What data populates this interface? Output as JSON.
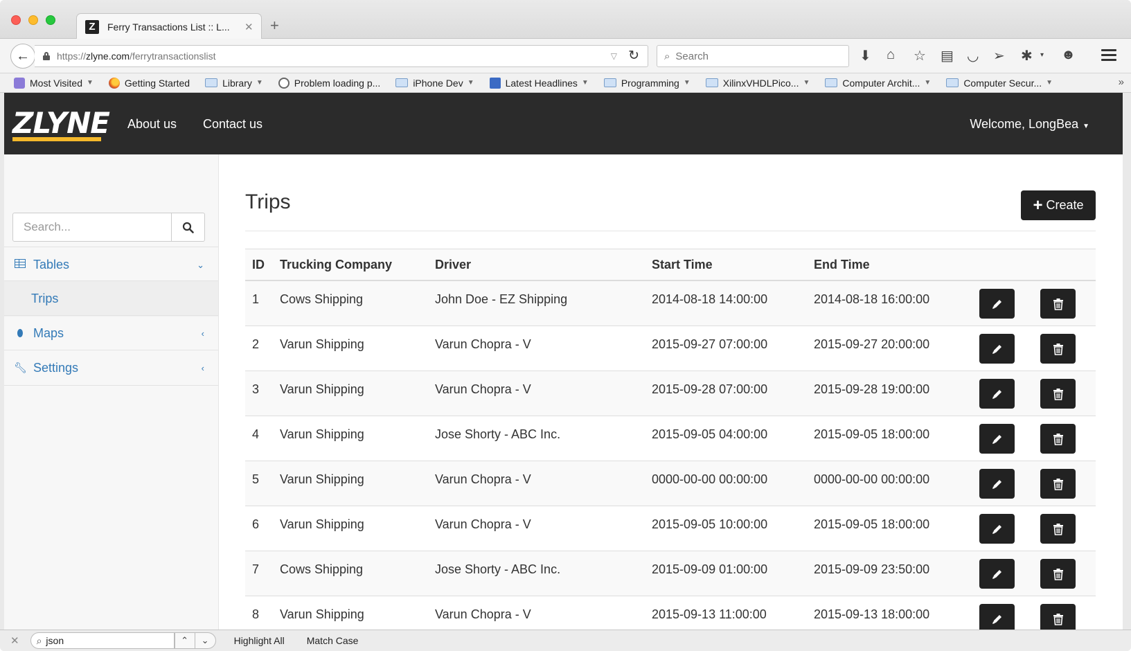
{
  "browser": {
    "tab_title": "Ferry Transactions List :: L...",
    "url_prefix": "https://",
    "url_domain": "zlyne.com",
    "url_path": "/ferrytransactionslist",
    "search_placeholder": "Search",
    "bookmarks": [
      {
        "label": "Most Visited",
        "icon": "most-visited-icon",
        "caret": true
      },
      {
        "label": "Getting Started",
        "icon": "firefox-icon",
        "caret": false
      },
      {
        "label": "Library",
        "icon": "folder-icon",
        "caret": true
      },
      {
        "label": "Problem loading p...",
        "icon": "globe-icon",
        "caret": false
      },
      {
        "label": "iPhone Dev",
        "icon": "folder-icon",
        "caret": true
      },
      {
        "label": "Latest Headlines",
        "icon": "rss-icon",
        "caret": true
      },
      {
        "label": "Programming",
        "icon": "folder-icon",
        "caret": true
      },
      {
        "label": "XilinxVHDLPico...",
        "icon": "folder-icon",
        "caret": true
      },
      {
        "label": "Computer Archit...",
        "icon": "folder-icon",
        "caret": true
      },
      {
        "label": "Computer Secur...",
        "icon": "folder-icon",
        "caret": true
      }
    ]
  },
  "header": {
    "logo_text": "ZLYNE",
    "nav": [
      "About us",
      "Contact us"
    ],
    "welcome": "Welcome, LongBea"
  },
  "sidebar": {
    "search_placeholder": "Search...",
    "items": [
      {
        "label": "Tables",
        "icon": "table-icon",
        "chevron": "down"
      },
      {
        "label": "Trips",
        "sub": true
      },
      {
        "label": "Maps",
        "icon": "map-marker-icon",
        "chevron": "left"
      },
      {
        "label": "Settings",
        "icon": "wrench-icon",
        "chevron": "left"
      }
    ]
  },
  "main": {
    "title": "Trips",
    "create_label": "Create",
    "columns": [
      "ID",
      "Trucking Company",
      "Driver",
      "Start Time",
      "End Time"
    ],
    "rows": [
      [
        "1",
        "Cows Shipping",
        "John Doe - EZ Shipping",
        "2014-08-18 14:00:00",
        "2014-08-18 16:00:00"
      ],
      [
        "2",
        "Varun Shipping",
        "Varun Chopra - V",
        "2015-09-27 07:00:00",
        "2015-09-27 20:00:00"
      ],
      [
        "3",
        "Varun Shipping",
        "Varun Chopra - V",
        "2015-09-28 07:00:00",
        "2015-09-28 19:00:00"
      ],
      [
        "4",
        "Varun Shipping",
        "Jose Shorty - ABC Inc.",
        "2015-09-05 04:00:00",
        "2015-09-05 18:00:00"
      ],
      [
        "5",
        "Varun Shipping",
        "Varun Chopra - V",
        "0000-00-00 00:00:00",
        "0000-00-00 00:00:00"
      ],
      [
        "6",
        "Varun Shipping",
        "Varun Chopra - V",
        "2015-09-05 10:00:00",
        "2015-09-05 18:00:00"
      ],
      [
        "7",
        "Cows Shipping",
        "Jose Shorty - ABC Inc.",
        "2015-09-09 01:00:00",
        "2015-09-09 23:50:00"
      ],
      [
        "8",
        "Varun Shipping",
        "Varun Chopra - V",
        "2015-09-13 11:00:00",
        "2015-09-13 18:00:00"
      ]
    ]
  },
  "findbar": {
    "query": "json",
    "highlight_all": "Highlight All",
    "match_case": "Match Case"
  },
  "colors": {
    "header_bg": "#2b2b2b",
    "logo_accent": "#f4b82b",
    "link": "#337ab7",
    "button_dark": "#222222"
  }
}
